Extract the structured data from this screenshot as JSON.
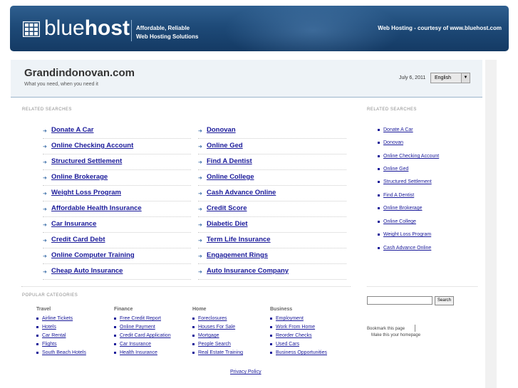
{
  "header": {
    "logo_blue": "blue",
    "logo_host": "host",
    "tagline_1": "Affordable, Reliable",
    "tagline_2": "Web Hosting Solutions",
    "right_text": "Web Hosting - courtesy of www.bluehost.com"
  },
  "domain": {
    "title": "Grandindonovan.com",
    "subtitle": "What you need, when you need it",
    "date": "July 6, 2011",
    "language": "English"
  },
  "related_label": "RELATED SEARCHES",
  "main_links_left": [
    "Donate A Car",
    "Online Checking Account",
    "Structured Settlement",
    "Online Brokerage",
    "Weight Loss Program",
    "Affordable Health Insurance",
    "Car Insurance",
    "Credit Card Debt",
    "Online Computer Training",
    "Cheap Auto Insurance"
  ],
  "main_links_right": [
    "Donovan",
    "Online Ged",
    "Find A Dentist",
    "Online College",
    "Cash Advance Online",
    "Credit Score",
    "Diabetic Diet",
    "Term Life Insurance",
    "Engagement Rings",
    "Auto Insurance Company"
  ],
  "sidebar": {
    "label": "RELATED SEARCHES",
    "links": [
      "Donate A Car",
      "Donovan",
      "Online Checking Account",
      "Online Ged",
      "Structured Settlement",
      "Find A Dentist",
      "Online Brokerage",
      "Online College",
      "Weight Loss Program",
      "Cash Advance Online"
    ],
    "search_button": "Search",
    "bookmark": "Bookmark this page",
    "homepage": "Make this your homepage"
  },
  "popular": {
    "label": "POPULAR CATEGORIES",
    "categories": [
      {
        "name": "Travel",
        "items": [
          "Airline Tickets",
          "Hotels",
          "Car Rental",
          "Flights",
          "South Beach Hotels"
        ]
      },
      {
        "name": "Finance",
        "items": [
          "Free Credit Report",
          "Online Payment",
          "Credit Card Application",
          "Car Insurance",
          "Health Insurance"
        ]
      },
      {
        "name": "Home",
        "items": [
          "Foreclosures",
          "Houses For Sale",
          "Mortgage",
          "People Search",
          "Real Estate Training"
        ]
      },
      {
        "name": "Business",
        "items": [
          "Employment",
          "Work From Home",
          "Reorder Checks",
          "Used Cars",
          "Business Opportunities"
        ]
      }
    ]
  },
  "footer": {
    "privacy": "Privacy Policy"
  }
}
